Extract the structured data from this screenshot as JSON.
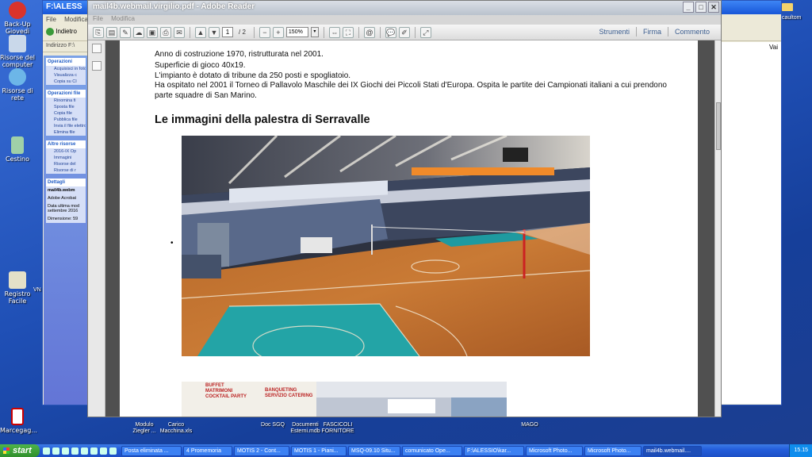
{
  "desktop": {
    "left_icons": [
      {
        "label": "Back-Up Giovedì"
      },
      {
        "label": "Risorse del computer"
      },
      {
        "label": "Risorse di rete"
      },
      {
        "label": "Cestino"
      },
      {
        "label": "Registro Facile"
      },
      {
        "label": "VN"
      },
      {
        "label": "Marcegag..."
      }
    ],
    "bottom_icons": [
      {
        "label": "Modulo Ziegler ..."
      },
      {
        "label": "Carico Macchina.xls"
      },
      {
        "label": "Doc SGQ"
      },
      {
        "label": "Documenti Esterni.mdb"
      },
      {
        "label": "FASCICOLI FORNITORE"
      },
      {
        "label": "MAGO"
      }
    ],
    "top_right": "caultom"
  },
  "explorer": {
    "title": "F:\\ALESS",
    "menu": [
      "File",
      "Modifica"
    ],
    "back_label": "Indietro",
    "address_label": "Indirizzo",
    "address_value": "F:\\",
    "go_label": "Vai",
    "task_boxes": [
      {
        "header": "Operazioni",
        "items": [
          "Acquisisci in fotocamera",
          "Visualizza c",
          "Copia su CI"
        ]
      },
      {
        "header": "Operazioni file",
        "items": [
          "Rinomina fi",
          "Sposta file",
          "Copia file",
          "Pubblica file",
          "Invia il file elettronica",
          "Elimina file"
        ]
      },
      {
        "header": "Altre risorse",
        "items": [
          "2016-IX Op",
          "Immagini",
          "Risorse del",
          "Risorse di r"
        ]
      }
    ],
    "details": {
      "header": "Dettagli",
      "name": "mail4b.webm",
      "type": "Adobe Acrobat",
      "date": "Data ultima mod settembre 2016",
      "size": "Dimensione: 59"
    }
  },
  "reader": {
    "title": "mail4b.webmail.virgilio.pdf - Adobe Reader",
    "menu": [
      "File",
      "Modifica"
    ],
    "page_current": "1",
    "page_total": "/ 2",
    "zoom": "150%",
    "right_tools": [
      "Strumenti",
      "Firma",
      "Commento"
    ],
    "doc": {
      "lines": [
        "Anno di costruzione 1970, ristrutturata nel 2001.",
        "Superficie di gioco 40x19.",
        "L'impianto è dotato di tribune da 250 posti e spogliatoio.",
        "Ha ospitato nel 2001 il Torneo di Pallavolo Maschile dei IX Giochi dei Piccoli Stati d'Europa. Ospita le partite dei Campionati italiani a cui prendono parte squadre di San Marino."
      ],
      "heading": "Le immagini della palestra di Serravalle",
      "bullet": "•",
      "banner_lines": [
        "BUFFET",
        "MATRIMONI",
        "COCKTAIL PARTY",
        "BANQUETING",
        "SERVIZIO CATERING"
      ]
    }
  },
  "taskbar": {
    "start": "start",
    "tasks": [
      {
        "label": "Posta eliminata ...",
        "active": false
      },
      {
        "label": "4 Promemoria",
        "active": false
      },
      {
        "label": "MOTIS 2 - Cont...",
        "active": false
      },
      {
        "label": "MOTIS 1 - Piani...",
        "active": false
      },
      {
        "label": "MSQ-09.10 Situ...",
        "active": false
      },
      {
        "label": "comunicato Ope...",
        "active": false
      },
      {
        "label": "F:\\ALESSIO\\kar...",
        "active": false
      },
      {
        "label": "Microsoft Photo...",
        "active": false
      },
      {
        "label": "Microsoft Photo...",
        "active": false
      },
      {
        "label": "mail4b.webmail....",
        "active": true
      }
    ],
    "clock": "15.15"
  }
}
